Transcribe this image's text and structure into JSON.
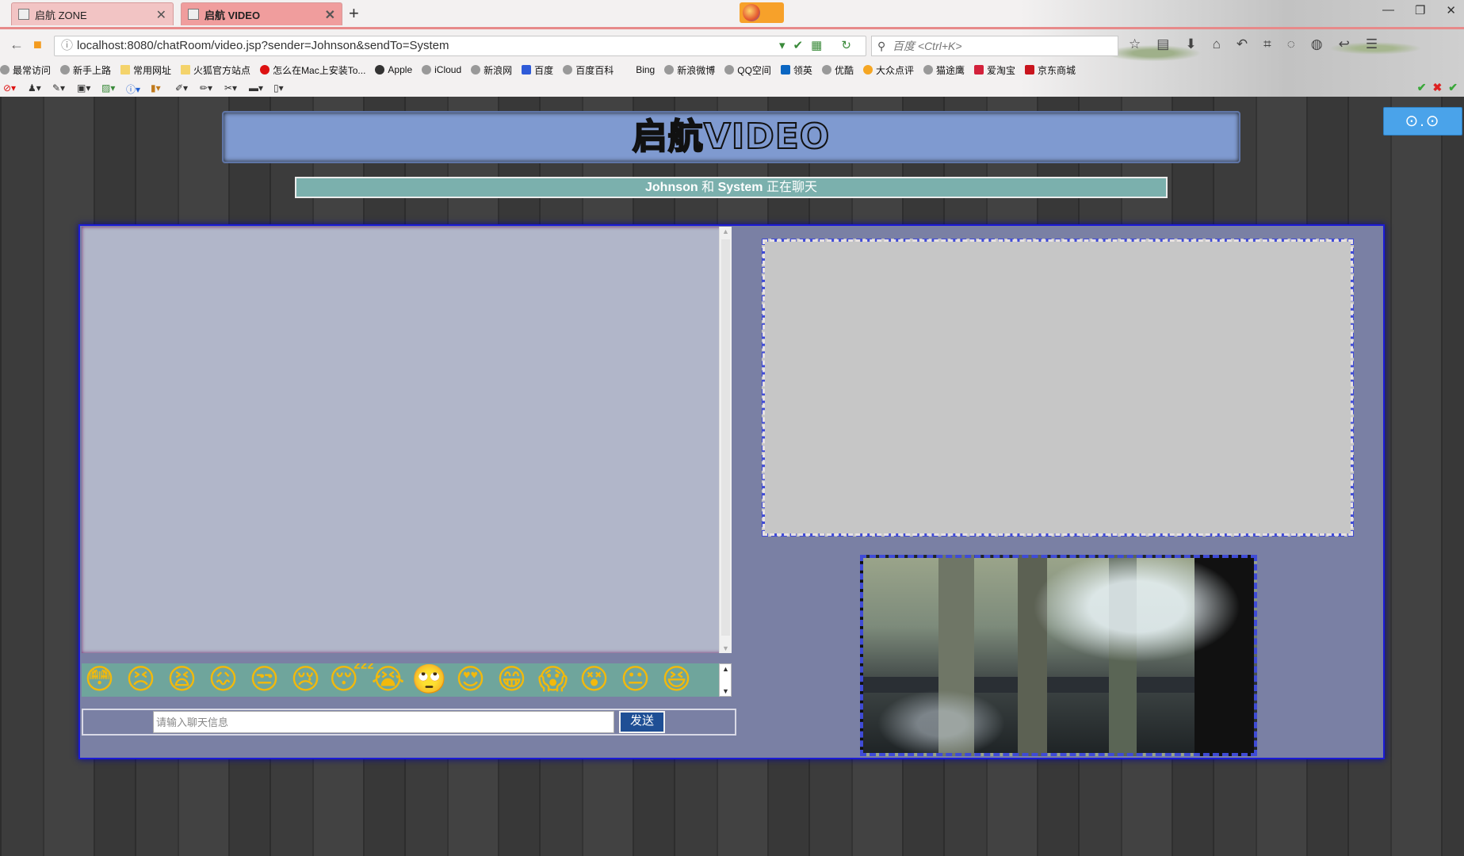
{
  "browser": {
    "tabs": [
      {
        "title": "启航 ZONE",
        "active": false
      },
      {
        "title": "启航 VIDEO",
        "active": true
      }
    ],
    "new_tab": "+",
    "url": "localhost:8080/chatRoom/video.jsp?sender=Johnson&sendTo=System",
    "search_placeholder": "百度 <Ctrl+K>",
    "bookmarks": [
      "最常访问",
      "新手上路",
      "常用网址",
      "火狐官方站点",
      "怎么在Mac上安装To...",
      "Apple",
      "iCloud",
      "新浪网",
      "百度",
      "百度百科",
      "Bing",
      "新浪微博",
      "QQ空间",
      "领英",
      "优酷",
      "大众点评",
      "猫途鹰",
      "爱淘宝",
      "京东商城"
    ]
  },
  "page": {
    "logo": "启航VIDEO",
    "corner_button": "⊙.⊙",
    "status": {
      "sender": "Johnson",
      "joiner": "和",
      "receiver": "System",
      "suffix": "正在聊天"
    },
    "chat": {
      "input_placeholder": "请输入聊天信息",
      "send_label": "发送"
    },
    "emojis": [
      "😳",
      "😣",
      "😫",
      "😖",
      "😒",
      "😢",
      "😴",
      "😭",
      "🙄",
      "😍",
      "😁",
      "😱",
      "😵",
      "😐",
      "😆"
    ]
  },
  "colors": {
    "tab_active": "#f09d9d",
    "logo_bar": "#7f9ad0",
    "status_bar": "#7bb0ad",
    "panel_bg": "#7a80a4",
    "panel_border": "#1b1bd6",
    "chat_log_bg": "#b1b6c9",
    "send_button": "#1f4f95",
    "corner_button": "#4aa3ea"
  }
}
